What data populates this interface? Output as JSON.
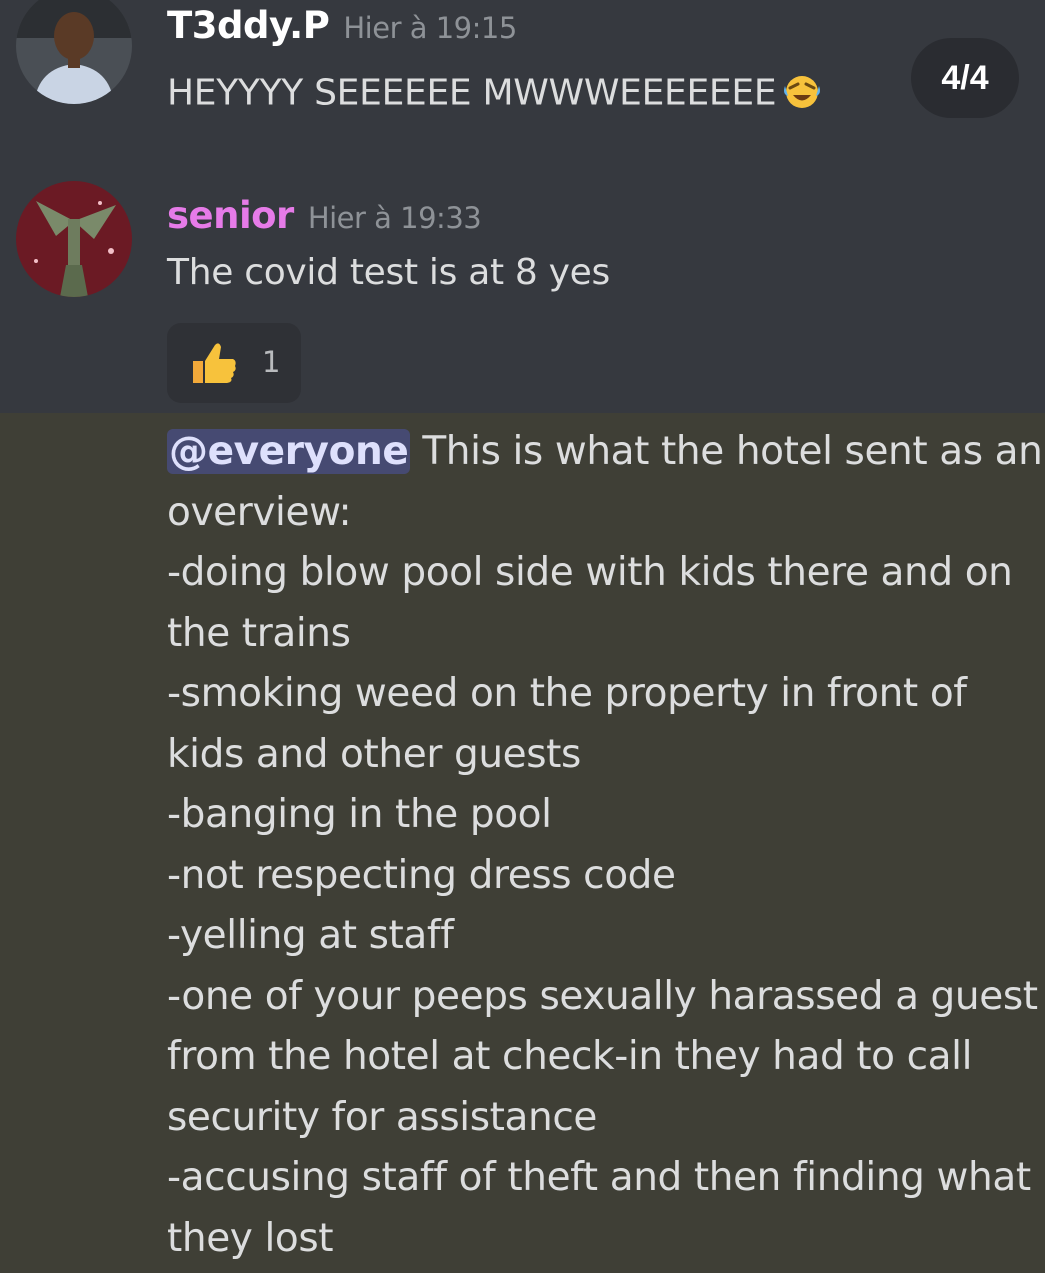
{
  "messages": [
    {
      "username": "T3ddy.P",
      "timestamp": "Hier à 19:15",
      "text": "HEYYYY SEEEEEE MWWWEEEEEEE",
      "emoji": "laughing-crying-emoji",
      "username_color": "#ffffff"
    },
    {
      "username": "senior",
      "timestamp": "Hier à 19:33",
      "text": "The covid test is at 8 yes",
      "username_color": "#e67be8",
      "reaction": {
        "emoji": "thumbs-up-icon",
        "count": "1"
      }
    }
  ],
  "page_badge": "4/4",
  "highlighted_message": {
    "mention": "@everyone",
    "lines": [
      " This is what the hotel sent as an",
      "overview:",
      "-doing blow pool side with kids there and on",
      "the trains",
      "-smoking weed on the property in front of",
      "kids and other guests",
      "-banging in the pool",
      "-not respecting dress code",
      "-yelling at staff",
      "-one of your peeps sexually harassed a guest",
      "from the hotel at check-in they had to call",
      "security for assistance",
      "-accusing staff of theft and then finding what",
      "they lost"
    ]
  },
  "colors": {
    "background": "#36393f",
    "highlight_background": "#3f3f36",
    "mention_background": "#5865f2",
    "text": "#dcddde",
    "timestamp": "#8e9297"
  }
}
